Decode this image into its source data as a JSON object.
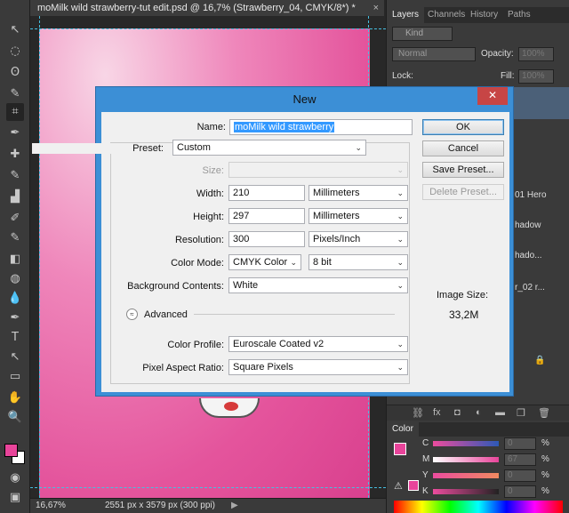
{
  "document": {
    "tab_title": "moMilk wild strawberry-tut edit.psd @ 16,7% (Strawberry_04, CMYK/8*) *",
    "close": "×"
  },
  "status_bar": {
    "zoom": "16,67%",
    "doc_info": "2551 px x 3579 px (300 ppi)",
    "arrow": "▶"
  },
  "toolbar": {
    "tools": [
      "↖",
      "◌",
      "ʘ",
      "✎",
      "⌗",
      "✒",
      "✚",
      "✎",
      "▟",
      "✐",
      "✎",
      "◧",
      "◍",
      "💧",
      "●",
      "✒",
      "T",
      "↖",
      "▭",
      "✋",
      "🔍"
    ]
  },
  "colors": {
    "foreground": "#e8449a",
    "background": "#ffffff",
    "canvas_pink": "#e4549c",
    "dialog_accent": "#3c8fd6"
  },
  "layers_panel": {
    "tabs": [
      "Layers",
      "Channels",
      "History",
      "Paths"
    ],
    "kind": "Kind",
    "blend_mode": "Normal",
    "opacity_label": "Opacity:",
    "opacity_value": "100%",
    "lock_label": "Lock:",
    "fill_label": "Fill:",
    "fill_value": "100%",
    "fragments": [
      "01 Hero",
      "hadow",
      "hado...",
      "r_02 r..."
    ],
    "footer_icons": [
      "link-icon",
      "fx-icon",
      "mask-icon",
      "adjustment-icon",
      "group-icon",
      "new-layer-icon",
      "trash-icon"
    ]
  },
  "color_panel": {
    "tab": "Color",
    "channels": [
      {
        "label": "C",
        "value": "0",
        "pct": "%"
      },
      {
        "label": "M",
        "value": "67",
        "pct": "%"
      },
      {
        "label": "Y",
        "value": "0",
        "pct": "%"
      },
      {
        "label": "K",
        "value": "0",
        "pct": "%"
      }
    ]
  },
  "dialog": {
    "title": "New",
    "close": "✕",
    "name_label": "Name:",
    "name_value": "moMilk wild strawberry",
    "preset_label": "Preset:",
    "preset_value": "Custom",
    "size_label": "Size:",
    "width_label": "Width:",
    "width_value": "210",
    "width_unit": "Millimeters",
    "height_label": "Height:",
    "height_value": "297",
    "height_unit": "Millimeters",
    "resolution_label": "Resolution:",
    "resolution_value": "300",
    "resolution_unit": "Pixels/Inch",
    "color_mode_label": "Color Mode:",
    "color_mode_value": "CMYK Color",
    "bit_depth_value": "8 bit",
    "bg_contents_label": "Background Contents:",
    "bg_contents_value": "White",
    "advanced_label": "Advanced",
    "advanced_toggle": "≈",
    "color_profile_label": "Color Profile:",
    "color_profile_value": "Euroscale Coated v2",
    "pixel_aspect_label": "Pixel Aspect Ratio:",
    "pixel_aspect_value": "Square Pixels",
    "ok_label": "OK",
    "cancel_label": "Cancel",
    "save_preset_label": "Save Preset...",
    "delete_preset_label": "Delete Preset...",
    "image_size_label": "Image Size:",
    "image_size_value": "33,2M",
    "dropdown_arrow": "⌄"
  }
}
